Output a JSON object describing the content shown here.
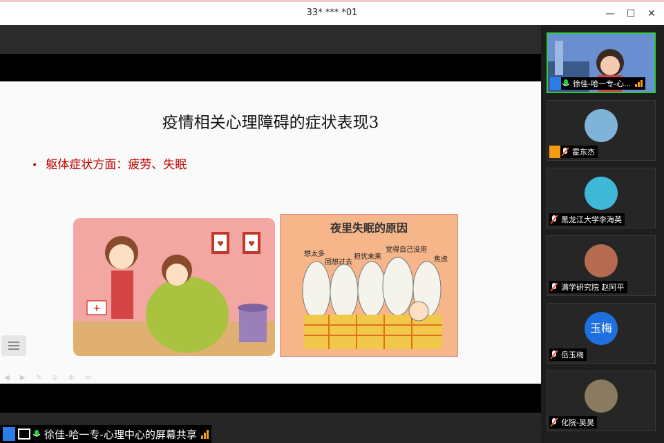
{
  "window": {
    "title": "33* *** *01"
  },
  "slide": {
    "title": "疫情相关心理障碍的症状表现3",
    "bullet": "躯体症状方面：疲劳、失眠",
    "image2_caption": "夜里失眠的原因",
    "image2_labels": [
      "想太多",
      "回想过去",
      "担忧未来",
      "觉得自己没用",
      "焦虑"
    ]
  },
  "participants": [
    {
      "name": "徐佳-哈一专-心...",
      "avatar_text": "",
      "active": true,
      "muted": false,
      "color": "#6a8fd0"
    },
    {
      "name": "霍东杰",
      "avatar_text": "",
      "active": false,
      "muted": true,
      "color": "#7fb3d8"
    },
    {
      "name": "黑龙江大学李海英",
      "avatar_text": "",
      "active": false,
      "muted": true,
      "color": "#3fb7d6"
    },
    {
      "name": "满学研究院 赵阿平",
      "avatar_text": "",
      "active": false,
      "muted": true,
      "color": "#b56b4f"
    },
    {
      "name": "岳玉梅",
      "avatar_text": "玉梅",
      "active": false,
      "muted": true,
      "color": "#1e6fe0"
    },
    {
      "name": "化院-吴昊",
      "avatar_text": "",
      "active": false,
      "muted": true,
      "color": "#8a7a60"
    }
  ],
  "share_bar": {
    "label": "徐佳-哈一专-心理中心的屏幕共享"
  },
  "colors": {
    "active_border": "#2ecc40",
    "bullet": "#c00000",
    "signal": "#f39c12"
  }
}
